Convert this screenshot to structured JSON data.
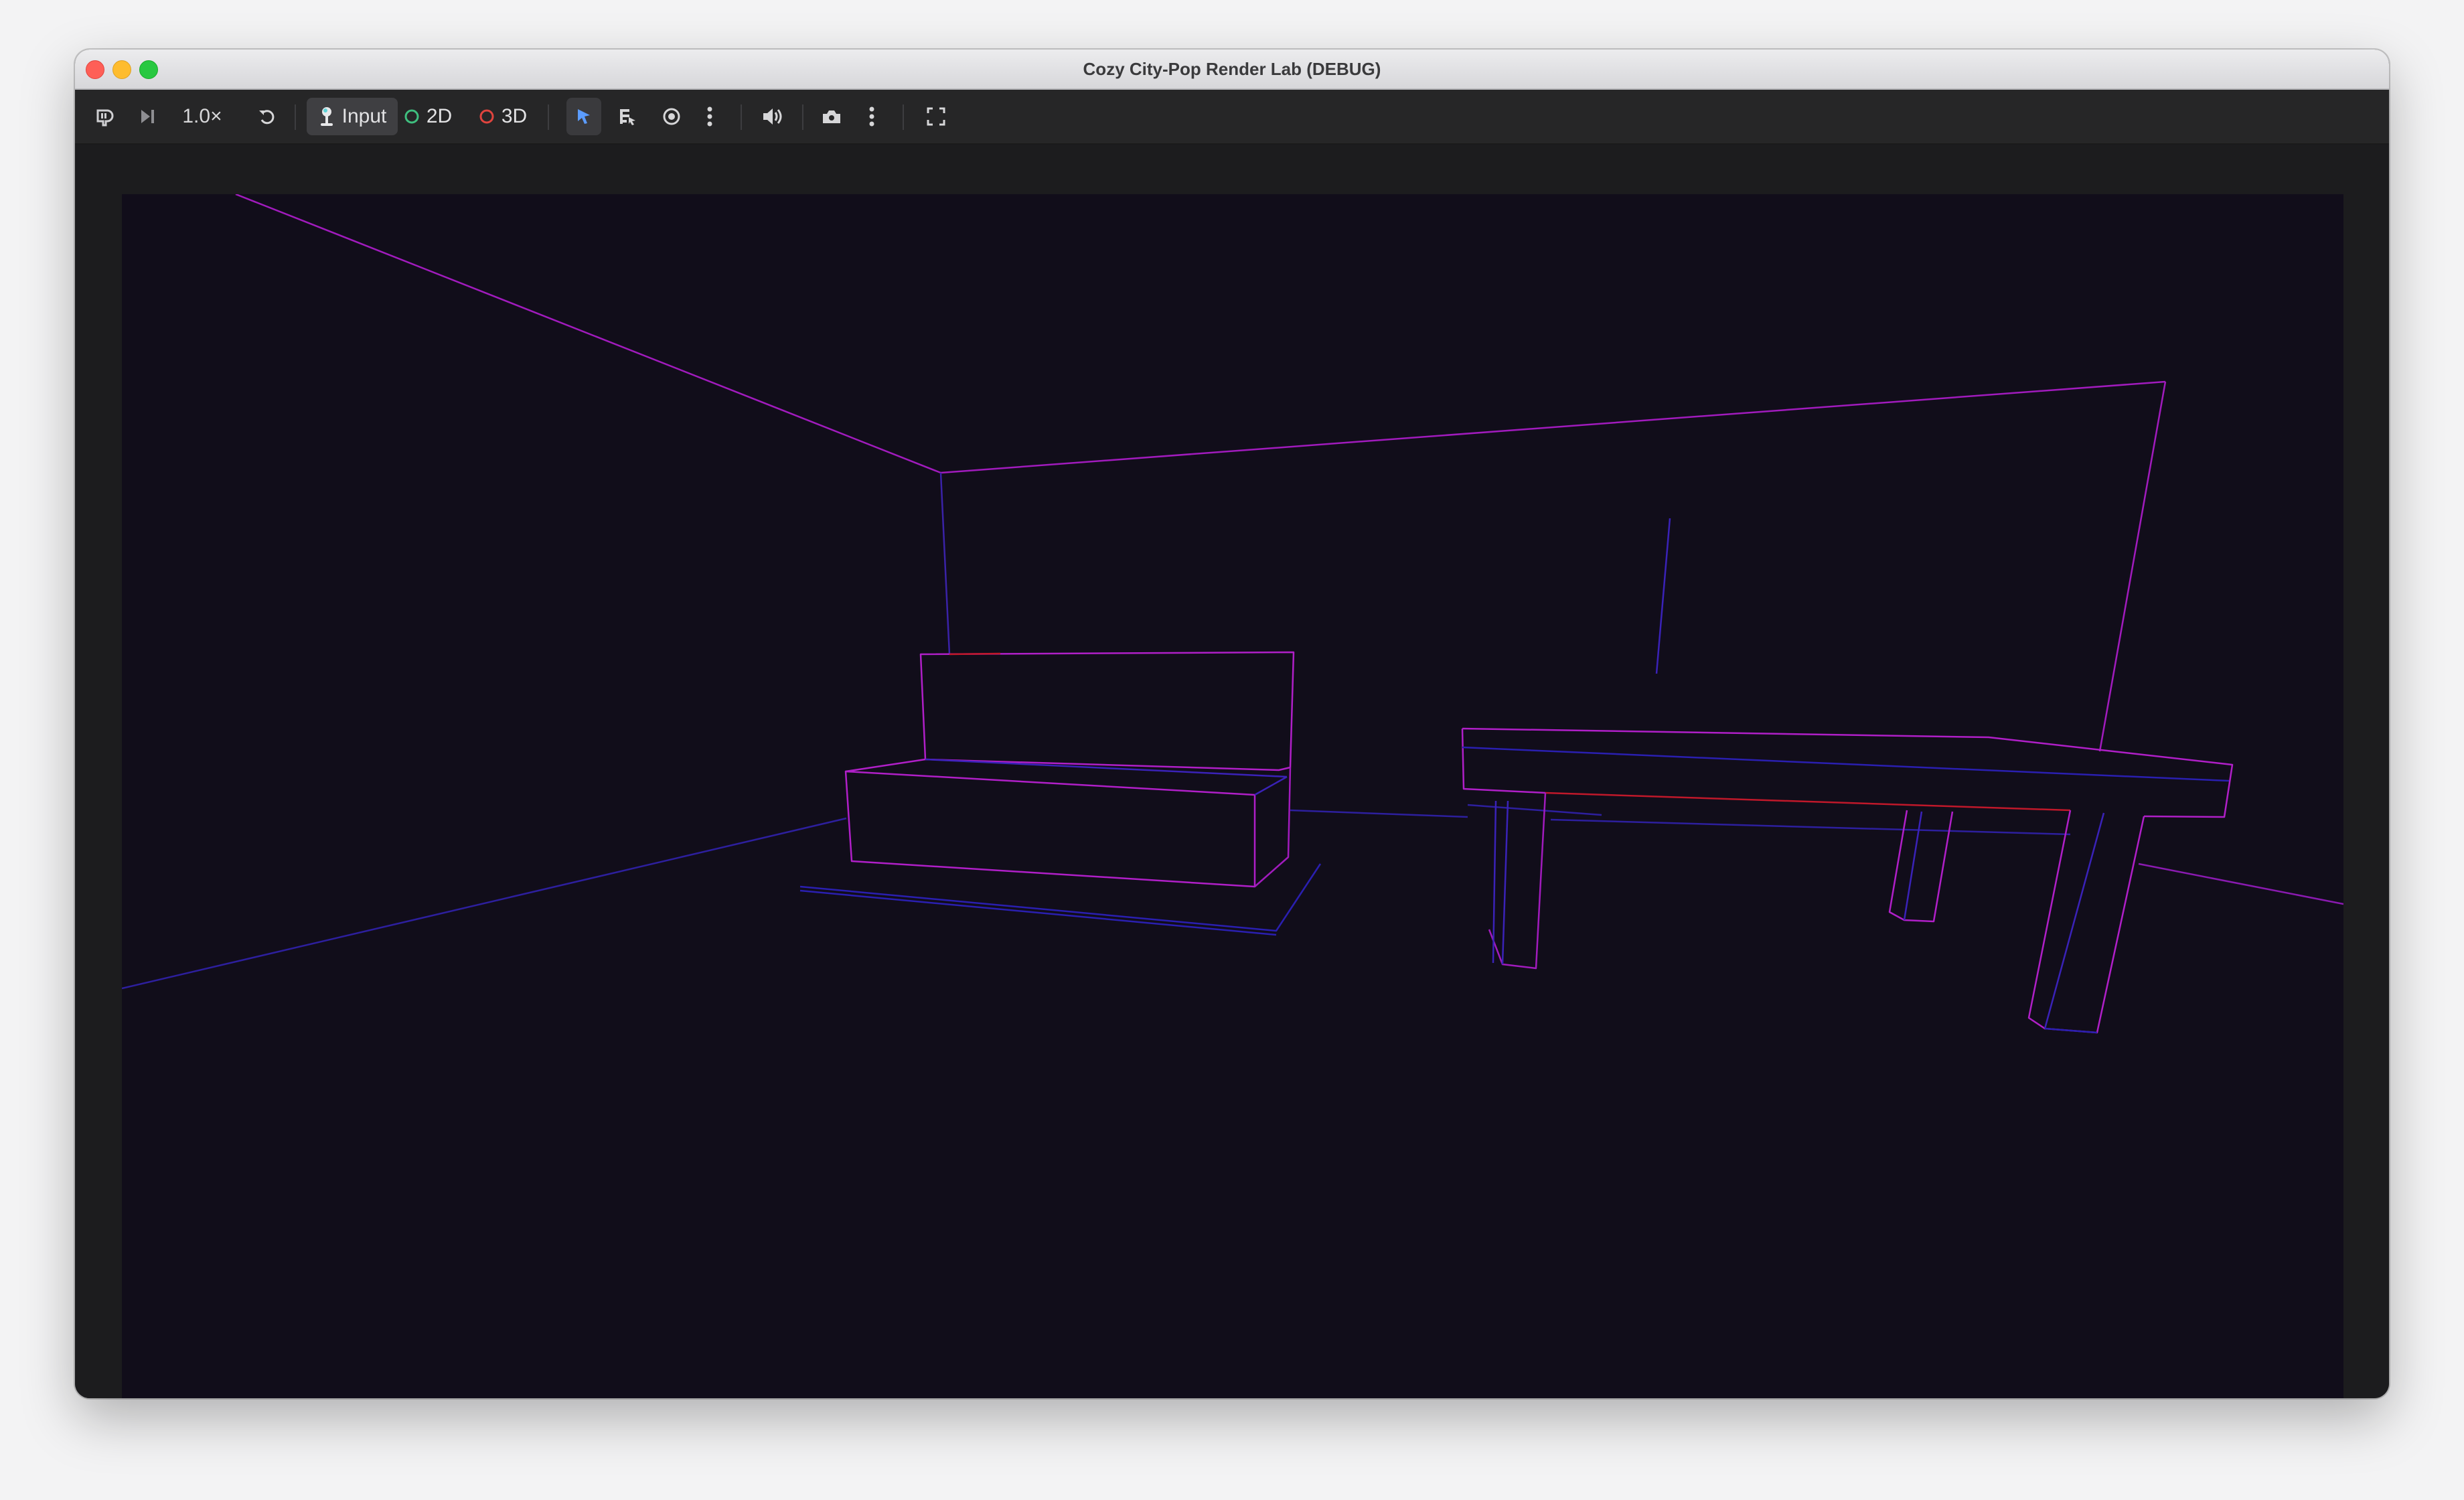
{
  "window": {
    "title": "Cozy City-Pop Render Lab (DEBUG)"
  },
  "toolbar": {
    "game_icon": "gamepad-pause-icon",
    "step_icon": "next-frame-icon",
    "speed_label": "1.0×",
    "reset_icon": "rotate-ccw-icon",
    "input_label": "Input",
    "mode_2d_label": "2D",
    "mode_3d_label": "3D",
    "mode_2d_color": "#3fbf7f",
    "mode_3d_color": "#e0443e",
    "select_icon": "cursor-arrow-icon",
    "list_icon": "list-select-icon",
    "eye_icon": "eye-icon",
    "more_icon": "vertical-ellipsis-icon",
    "audio_icon": "speaker-icon",
    "camera_icon": "camera-icon",
    "more2_icon": "vertical-ellipsis-icon",
    "fullscreen_icon": "fullscreen-icon"
  },
  "viewport": {
    "background": "#110d1a",
    "wire_colors": {
      "magenta": "#b01fc8",
      "blue": "#2a1fb0",
      "red": "#c0182a"
    }
  }
}
